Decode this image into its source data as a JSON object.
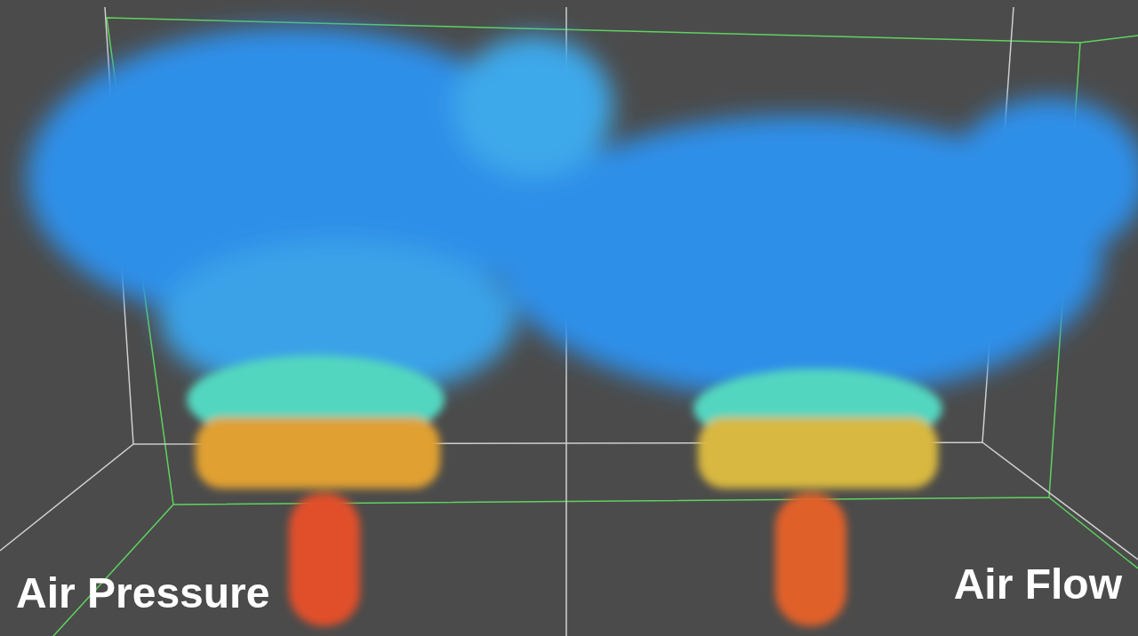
{
  "viewport": {
    "left_caption": "Air Pressure",
    "right_caption": "Air Flow"
  }
}
